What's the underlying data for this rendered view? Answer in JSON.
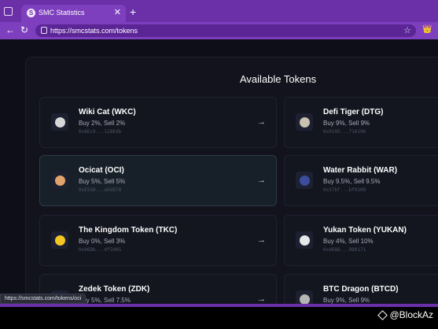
{
  "browser": {
    "tab_title": "SMC Statistics",
    "tab_close": "✕",
    "new_tab": "+",
    "back": "←",
    "reload": "↻",
    "url": "https://smcstats.com/tokens",
    "star": "☆",
    "extension": "👑",
    "status_url": "https://smcstats.com/tokens/oci"
  },
  "page": {
    "heading": "Available Tokens",
    "accent_color": "#6b2fa8",
    "tokens": [
      {
        "name": "Wiki Cat (WKC)",
        "tax": "Buy 2%, Sell 2%",
        "address": "0x6Ec9...128Edb",
        "icon_color": "#d8d8d8",
        "active": false
      },
      {
        "name": "Defi Tiger (DTG)",
        "tax": "Buy 9%, Sell 9%",
        "address": "0x0195...71A196",
        "icon_color": "#c9c2b2",
        "active": false
      },
      {
        "name": "Ocicat (OCI)",
        "tax": "Buy 5%, Sell 5%",
        "address": "0xE5S0...a5d870",
        "icon_color": "#e2a26b",
        "active": true
      },
      {
        "name": "Water Rabbit (WAR)",
        "tax": "Buy 9.5%, Sell 9.5%",
        "address": "0x57bf...bf020D",
        "icon_color": "#3b4d9b",
        "active": false
      },
      {
        "name": "The Kingdom Token (TKC)",
        "tax": "Buy 0%, Sell 3%",
        "address": "0x06Db...4f5005",
        "icon_color": "#f3c623",
        "active": false
      },
      {
        "name": "Yukan Token (YUKAN)",
        "tax": "Buy 4%, Sell 10%",
        "address": "0xd686...980171",
        "icon_color": "#e8e8e8",
        "active": false
      },
      {
        "name": "Zedek Token (ZDK)",
        "tax": "Buy 5%, Sell 7.5%",
        "address": "",
        "icon_color": "#8a5cd6",
        "active": false
      },
      {
        "name": "BTC Dragon (BTCD)",
        "tax": "Buy 9%, Sell 9%",
        "address": "",
        "icon_color": "#b5b5b5",
        "active": false
      }
    ],
    "arrow": "→"
  },
  "footer": {
    "watermark": "@BlockAz"
  }
}
